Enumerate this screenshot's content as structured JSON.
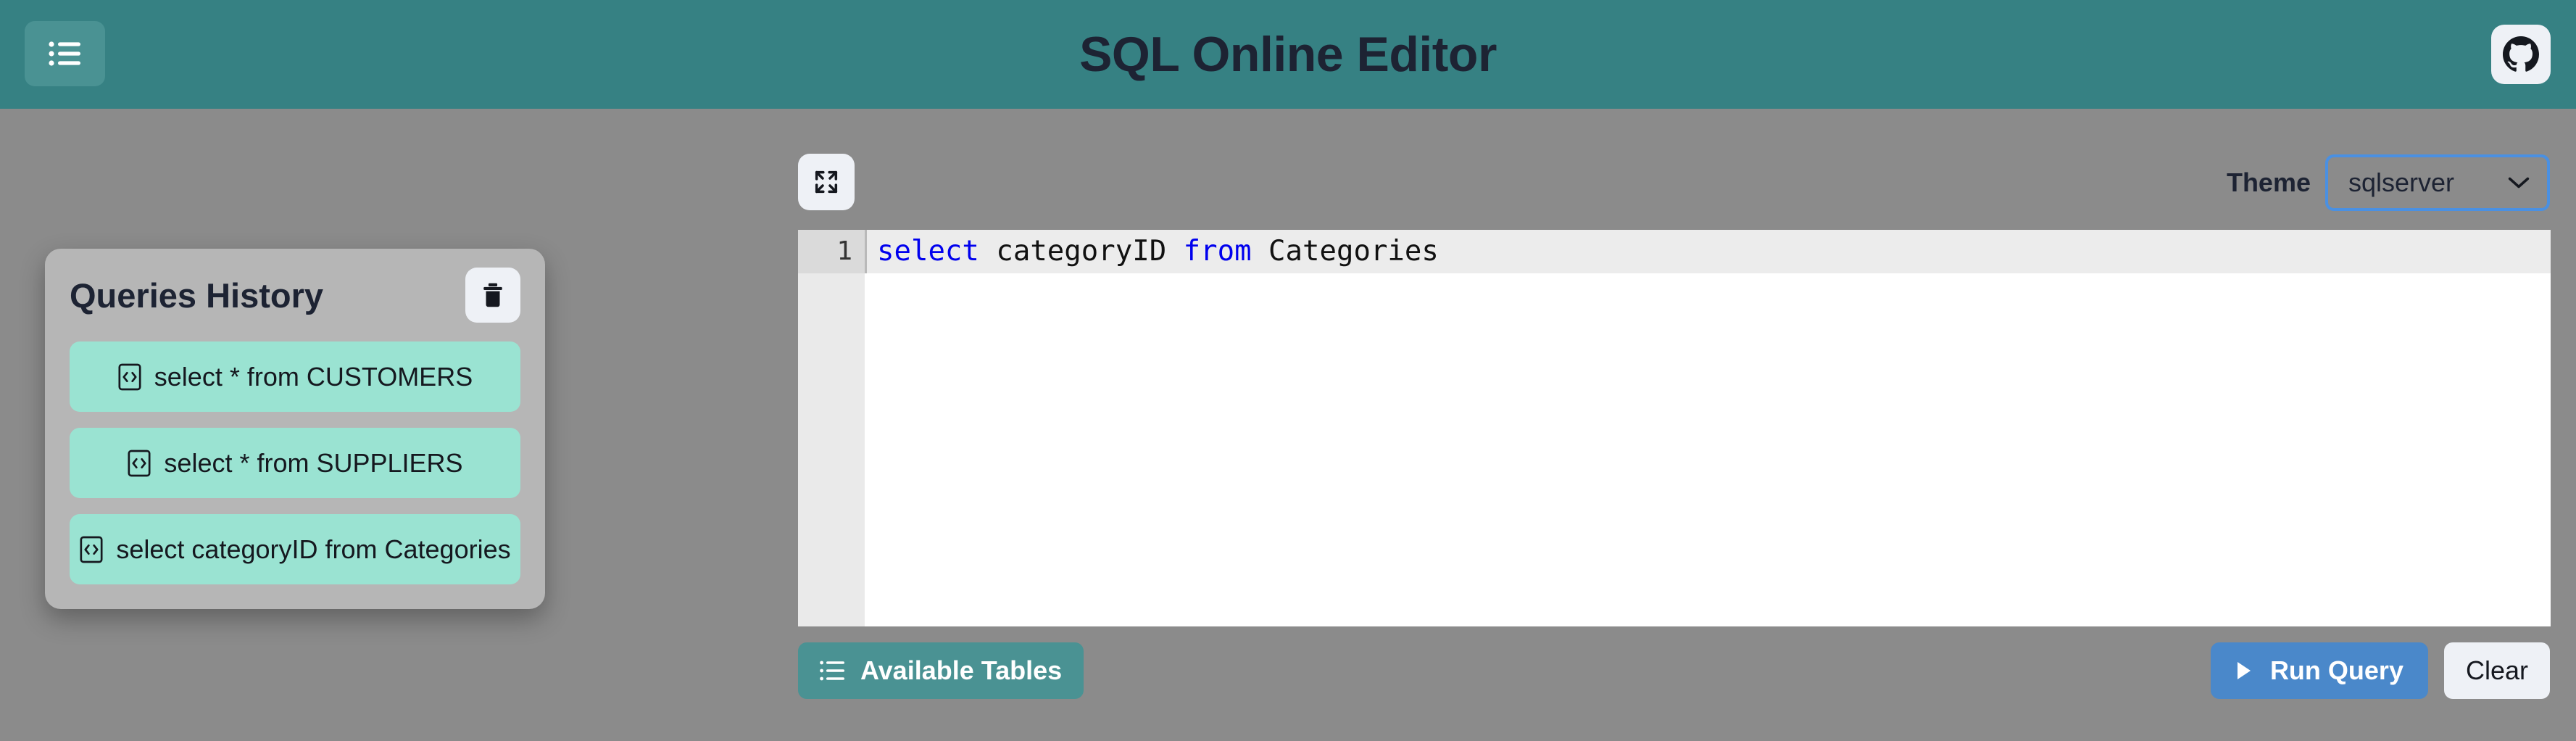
{
  "header": {
    "menu_icon": "list-icon",
    "title": "SQL Online Editor",
    "github_icon": "github-icon",
    "background_color": "#368183",
    "menu_button_color": "#4a9293",
    "title_color": "#1d2333"
  },
  "history": {
    "title": "Queries History",
    "clear_history_icon": "trash-icon",
    "item_icon": "code-brackets-icon",
    "panel_color": "#b6b6b6",
    "item_color": "#9ae3d2",
    "items": [
      {
        "label": "select * from CUSTOMERS"
      },
      {
        "label": "select * from SUPPLIERS"
      },
      {
        "label": "select categoryID from Categories"
      }
    ]
  },
  "toolbar": {
    "fullscreen_icon": "expand-icon",
    "theme_label": "Theme",
    "theme_value": "sqlserver",
    "theme_chevron_icon": "chevron-down-icon",
    "theme_focus_color": "#4a90e2"
  },
  "editor": {
    "line_number": "1",
    "code_tokens": [
      {
        "text": "select",
        "type": "keyword"
      },
      {
        "text": " categoryID ",
        "type": "plain"
      },
      {
        "text": "from",
        "type": "keyword"
      },
      {
        "text": " Categories",
        "type": "plain"
      }
    ],
    "keyword_color": "#0000ee",
    "gutter_color": "#eaeaea",
    "active_line_color": "#ececec"
  },
  "actions": {
    "available_tables_label": "Available Tables",
    "available_tables_icon": "list-icon",
    "run_query_label": "Run Query",
    "run_query_icon": "play-icon",
    "clear_label": "Clear",
    "run_button_color": "#4a88ca",
    "available_button_color": "#4a9293"
  },
  "page": {
    "background_color": "#8b8b8b"
  }
}
